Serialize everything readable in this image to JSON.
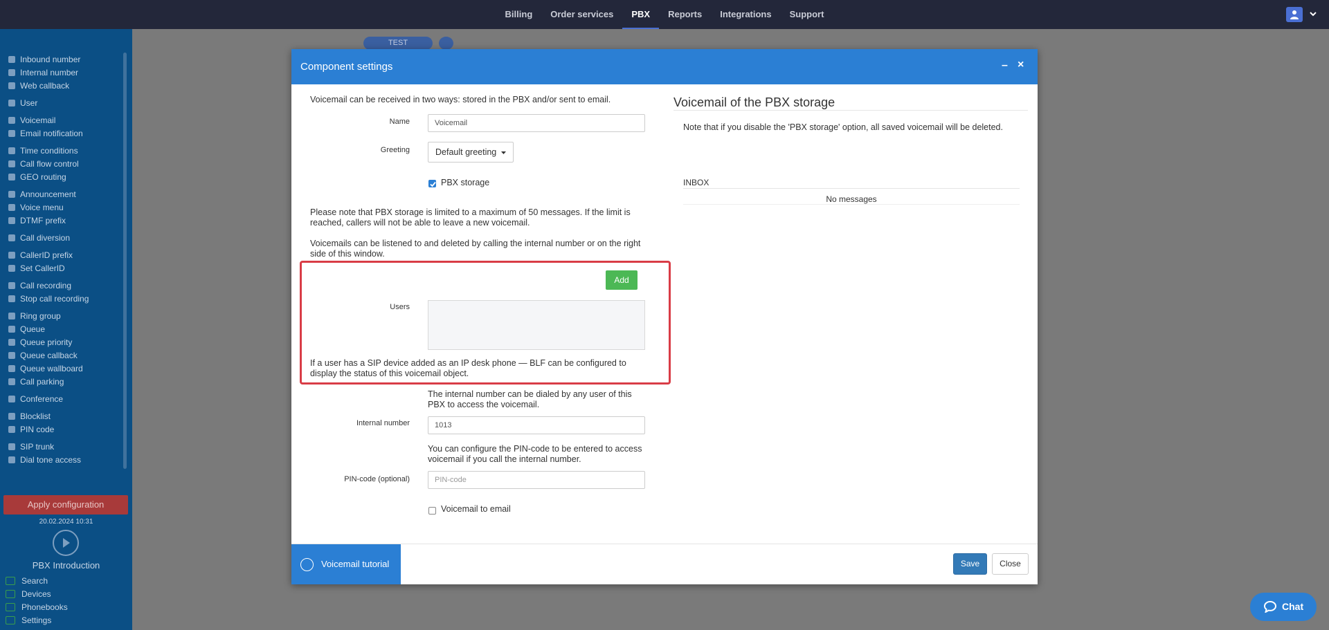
{
  "topnav": {
    "items": [
      "Billing",
      "Order services",
      "PBX",
      "Reports",
      "Integrations",
      "Support"
    ],
    "active": "PBX"
  },
  "sidebar": {
    "items": [
      {
        "label": "Inbound number",
        "icon": "plus-circle-icon"
      },
      {
        "label": "Internal number",
        "icon": "map-pin-icon"
      },
      {
        "label": "Web callback",
        "icon": "history-icon"
      },
      {
        "label": "User",
        "icon": "user-icon",
        "gap": true
      },
      {
        "label": "Voicemail",
        "icon": "envelope-icon",
        "gap": true
      },
      {
        "label": "Email notification",
        "icon": "bell-icon"
      },
      {
        "label": "Time conditions",
        "icon": "clock-icon",
        "gap": true
      },
      {
        "label": "Call flow control",
        "icon": "toggle-icon"
      },
      {
        "label": "GEO routing",
        "icon": "sitemap-icon"
      },
      {
        "label": "Announcement",
        "icon": "megaphone-icon",
        "gap": true
      },
      {
        "label": "Voice menu",
        "icon": "grid-icon"
      },
      {
        "label": "DTMF prefix",
        "icon": "code-icon"
      },
      {
        "label": "Call diversion",
        "icon": "refresh-icon",
        "gap": true
      },
      {
        "label": "CallerID prefix",
        "icon": "list-icon",
        "gap": true
      },
      {
        "label": "Set CallerID",
        "icon": "id-card-icon"
      },
      {
        "label": "Call recording",
        "icon": "microphone-icon",
        "gap": true
      },
      {
        "label": "Stop call recording",
        "icon": "microphone-slash-icon"
      },
      {
        "label": "Ring group",
        "icon": "users-icon",
        "gap": true
      },
      {
        "label": "Queue",
        "icon": "user-plus-icon"
      },
      {
        "label": "Queue priority",
        "icon": "arrow-up-icon"
      },
      {
        "label": "Queue callback",
        "icon": "share-icon"
      },
      {
        "label": "Queue wallboard",
        "icon": "table-icon"
      },
      {
        "label": "Call parking",
        "icon": "parking-icon"
      },
      {
        "label": "Conference",
        "icon": "comments-icon",
        "gap": true
      },
      {
        "label": "Blocklist",
        "icon": "ban-icon",
        "gap": true
      },
      {
        "label": "PIN code",
        "icon": "key-icon"
      },
      {
        "label": "SIP trunk",
        "icon": "server-icon",
        "gap": true
      },
      {
        "label": "Dial tone access",
        "icon": "lock-icon"
      }
    ],
    "apply_label": "Apply configuration",
    "apply_date": "20.02.2024 10:31",
    "intro_label": "PBX Introduction",
    "bottom_links": [
      {
        "label": "Search",
        "icon": "search-icon"
      },
      {
        "label": "Devices",
        "icon": "monitor-icon"
      },
      {
        "label": "Phonebooks",
        "icon": "book-icon"
      },
      {
        "label": "Settings",
        "icon": "gear-icon"
      }
    ]
  },
  "canvas": {
    "tab_label": "TEST"
  },
  "modal": {
    "title": "Component settings",
    "intro": "Voicemail can be received in two ways: stored in the PBX and/or sent to email.",
    "name_label": "Name",
    "name_value": "Voicemail",
    "greeting_label": "Greeting",
    "greeting_value": "Default greeting",
    "pbx_storage_label": "PBX storage",
    "pbx_storage_checked": true,
    "storage_note": "Please note that PBX storage is limited to a maximum of 50 messages. If the limit is reached, callers will not be able to leave a new voicemail.",
    "listen_note": "Voicemails can be listened to and deleted by calling the internal number or on the right side of this window.",
    "add_label": "Add",
    "users_label": "Users",
    "blf_note": "If a user has a SIP device added as an IP desk phone — BLF can be configured to display the status of this voicemail object.",
    "internal_note": "The internal number can be dialed by any user of this PBX to access the voicemail.",
    "internal_label": "Internal number",
    "internal_value": "1013",
    "pin_note": "You can configure the PIN-code to be entered to access voicemail if you call the internal number.",
    "pin_label": "PIN-code (optional)",
    "pin_placeholder": "PIN-code",
    "email_label": "Voicemail to email",
    "email_checked": false,
    "right_title": "Voicemail of the PBX storage",
    "right_note": "Note that if you disable the 'PBX storage' option, all saved voicemail will be deleted.",
    "inbox_label": "INBOX",
    "no_messages": "No messages",
    "tutorial_label": "Voicemail tutorial",
    "save_label": "Save",
    "close_label": "Close"
  },
  "chat": {
    "label": "Chat"
  },
  "colors": {
    "header_blue": "#2b7fd4",
    "highlight_red": "#d93c46",
    "add_green": "#4cb855",
    "sidebar_bg": "#0b4f85",
    "topbar_bg": "#23273a"
  }
}
